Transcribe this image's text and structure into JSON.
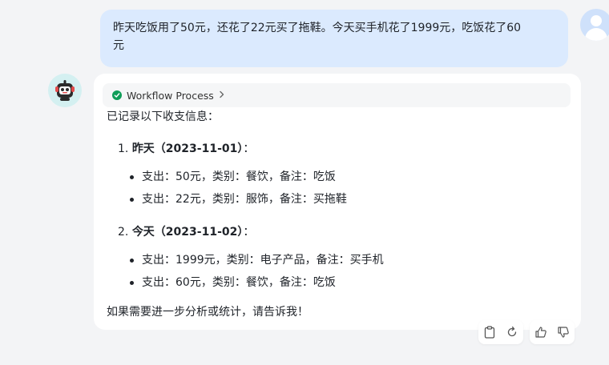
{
  "user_message": {
    "line1": "昨天吃饭用了50元，还花了22元买了拖鞋。今天买手机花了1999元，吃饭花了60",
    "line2": "元"
  },
  "assistant": {
    "workflow_label": "Workflow Process",
    "intro": "已记录以下收支信息：",
    "sections": [
      {
        "number": "1.",
        "title": "昨天（2023-11-01）",
        "suffix": "：",
        "items": [
          "支出：50元，类别：餐饮，备注：吃饭",
          "支出：22元，类别：服饰，备注：买拖鞋"
        ]
      },
      {
        "number": "2.",
        "title": "今天（2023-11-02）",
        "suffix": "：",
        "items": [
          "支出：1999元，类别：电子产品，备注：买手机",
          "支出：60元，类别：餐饮，备注：吃饭"
        ]
      }
    ],
    "closing": "如果需要进一步分析或统计，请告诉我！"
  },
  "icons": {
    "status": "check-circle-icon",
    "expand": "chevron-right-icon",
    "copy": "clipboard-icon",
    "regenerate": "refresh-icon",
    "like": "thumbs-up-icon",
    "dislike": "thumbs-down-icon"
  },
  "colors": {
    "user_bubble": "#dbeafe",
    "status_ok": "#0f9d58",
    "background": "#f3f4f6"
  }
}
